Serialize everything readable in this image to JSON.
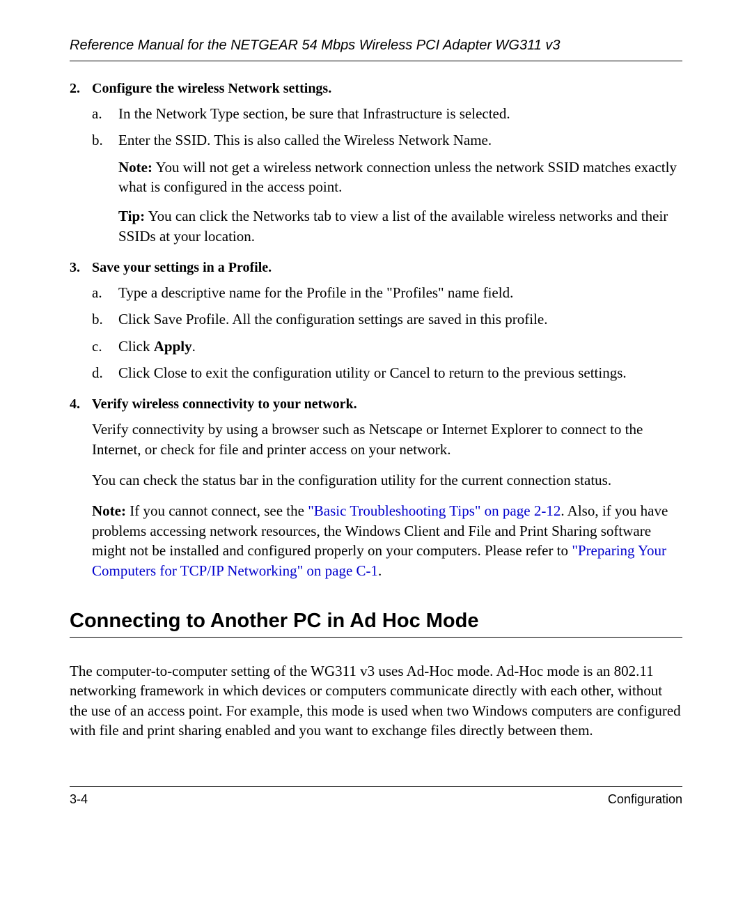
{
  "header": {
    "title": "Reference Manual for the NETGEAR 54 Mbps Wireless PCI Adapter WG311 v3"
  },
  "steps": {
    "s2": {
      "num": "2.",
      "title": "Configure the wireless Network settings.",
      "a_letter": "a.",
      "a_text": "In the Network Type section, be sure that Infrastructure is selected.",
      "b_letter": "b.",
      "b_text": "Enter the SSID. This is also called the Wireless Network Name.",
      "note_label": "Note:",
      "note_text": " You will not get a wireless network connection unless the network SSID matches exactly what is configured in the access point.",
      "tip_label": "Tip:",
      "tip_text": " You can click the Networks tab to view a list of the available wireless networks and their SSIDs at your location."
    },
    "s3": {
      "num": "3.",
      "title": "Save your settings in a Profile.",
      "a_letter": "a.",
      "a_text_1": "Type a descriptive name for the ",
      "a_text_2": "Profile in the \"Profiles\" name field.",
      "b_letter": "b.",
      "b_text": "Click Save Profile. All the configuration settings are saved in this profile.",
      "c_letter": "c.",
      "c_text_1": "Click ",
      "c_apply": "Apply",
      "c_text_2": ".",
      "d_letter": "d.",
      "d_text": "Click Close to exit the configuration utility or Cancel to return to the previous settings."
    },
    "s4": {
      "num": "4.",
      "title": "Verify wireless connectivity to your network.",
      "p1": "Verify connectivity by using a browser such as Netscape or Internet Explorer to connect to the Internet, or check for file and printer access on your network.",
      "p2": "You can check the status bar in the configuration utility for the current connection status.",
      "note_label": "Note:",
      "p3a": " If you cannot connect, see the ",
      "link1": "\"Basic Troubleshooting Tips\" on page 2-12",
      "p3b": ". Also, if you have problems accessing network resources, the Windows Client and File and Print Sharing software might not be installed and configured properly on your computers. Please refer to ",
      "link2": "\"Preparing Your Computers for TCP/IP Networking\" on page C-1",
      "p3c": "."
    }
  },
  "section": {
    "heading": "Connecting to Another PC in Ad Hoc Mode",
    "body": "The computer-to-computer setting of the WG311 v3 uses Ad-Hoc mode. Ad-Hoc mode is an 802.11 networking framework in which devices or computers communicate directly with each other, without the use of an access point. For example, this mode is used when two Windows computers are configured with file and print sharing enabled and you want to exchange files directly between them."
  },
  "footer": {
    "page": "3-4",
    "label": "Configuration"
  }
}
